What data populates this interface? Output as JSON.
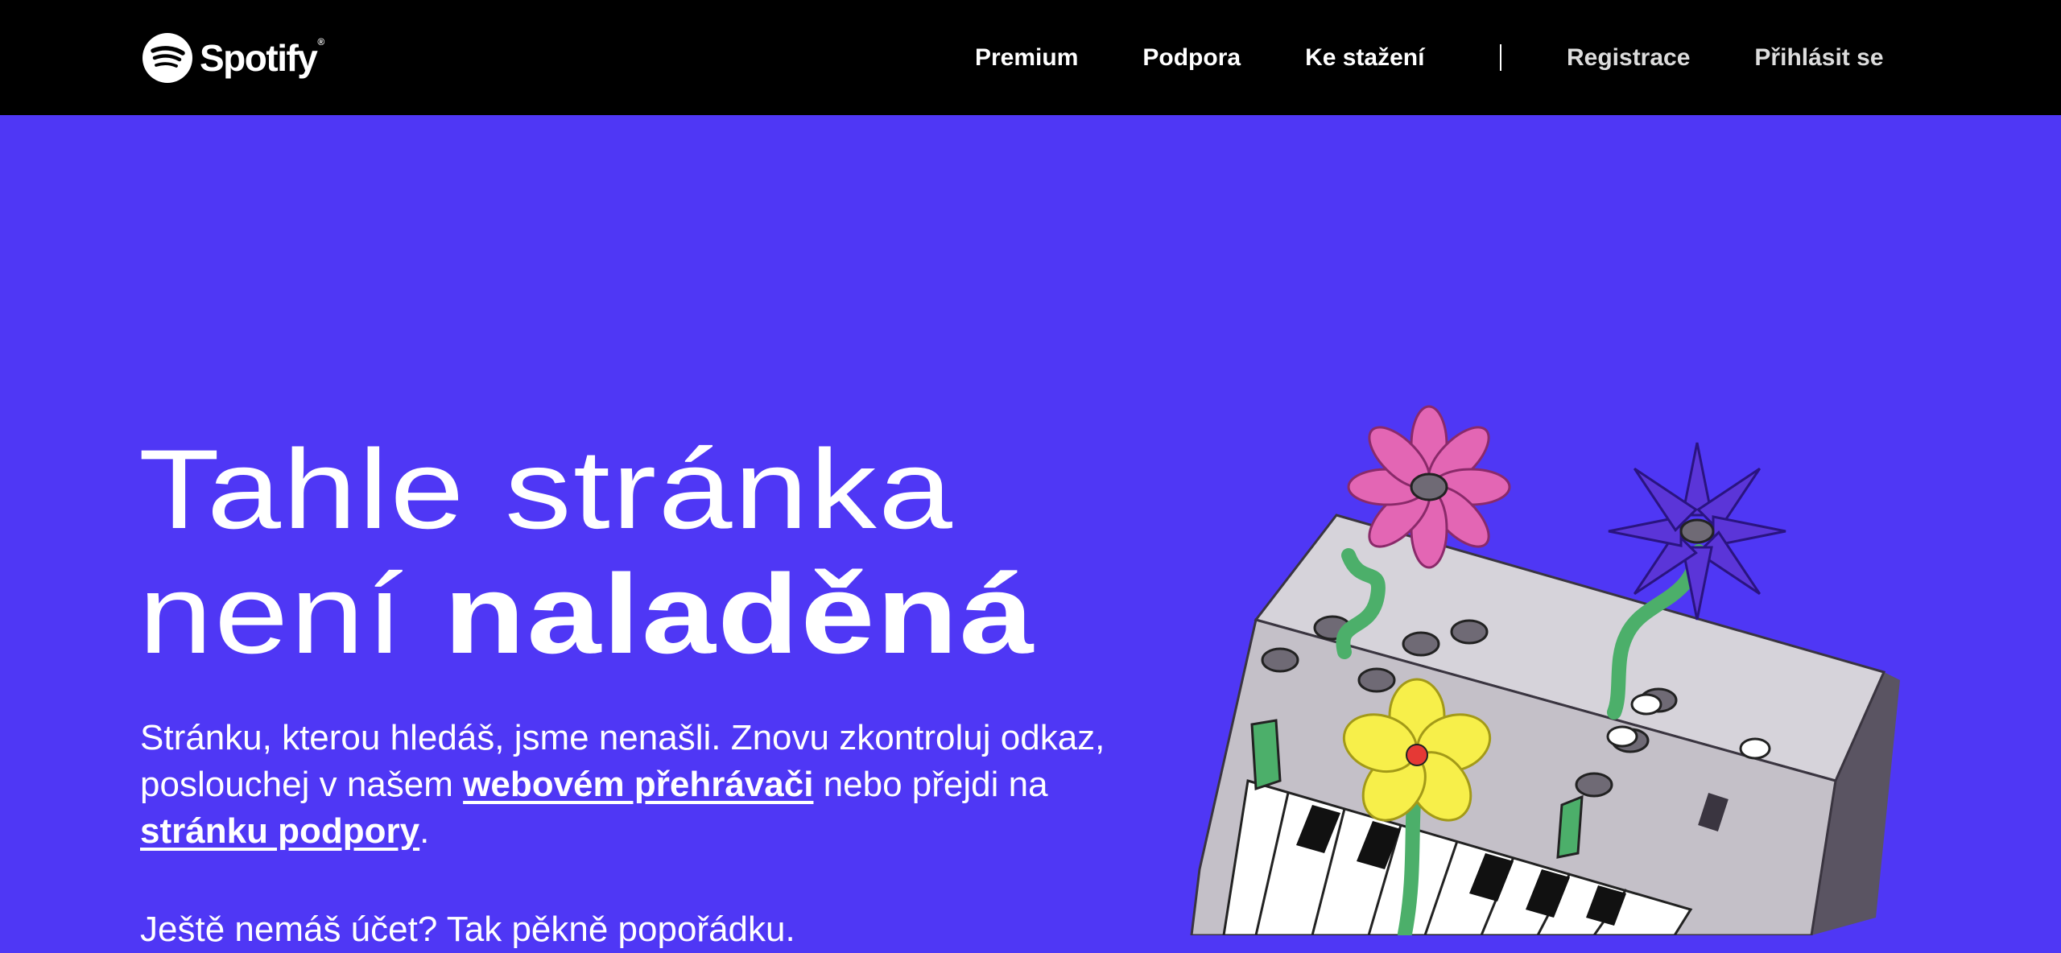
{
  "header": {
    "logo_text": "Spotify",
    "logo_reg": "®",
    "nav_primary": [
      "Premium",
      "Podpora",
      "Ke stažení"
    ],
    "nav_secondary": [
      "Registrace",
      "Přihlásit se"
    ]
  },
  "hero": {
    "headline_line1": "Tahle stránka",
    "headline_line2_plain": "není ",
    "headline_line2_bold": "naladěná",
    "body_part1": "Stránku, kterou hledáš, jsme nenašli. Znovu zkontroluj odkaz, poslouchej v našem ",
    "body_link1": "webovém přehrávači",
    "body_part2": " nebo přejdi na ",
    "body_link2": "stránku podpory",
    "body_part3": ".",
    "signup_text": "Ještě nemáš účet? Tak pěkně popořádku."
  },
  "colors": {
    "background": "#4f37f5",
    "topbar": "#000000",
    "text": "#ffffff"
  },
  "illustration": {
    "icon": "synthesizer-with-flowers-illustration"
  }
}
